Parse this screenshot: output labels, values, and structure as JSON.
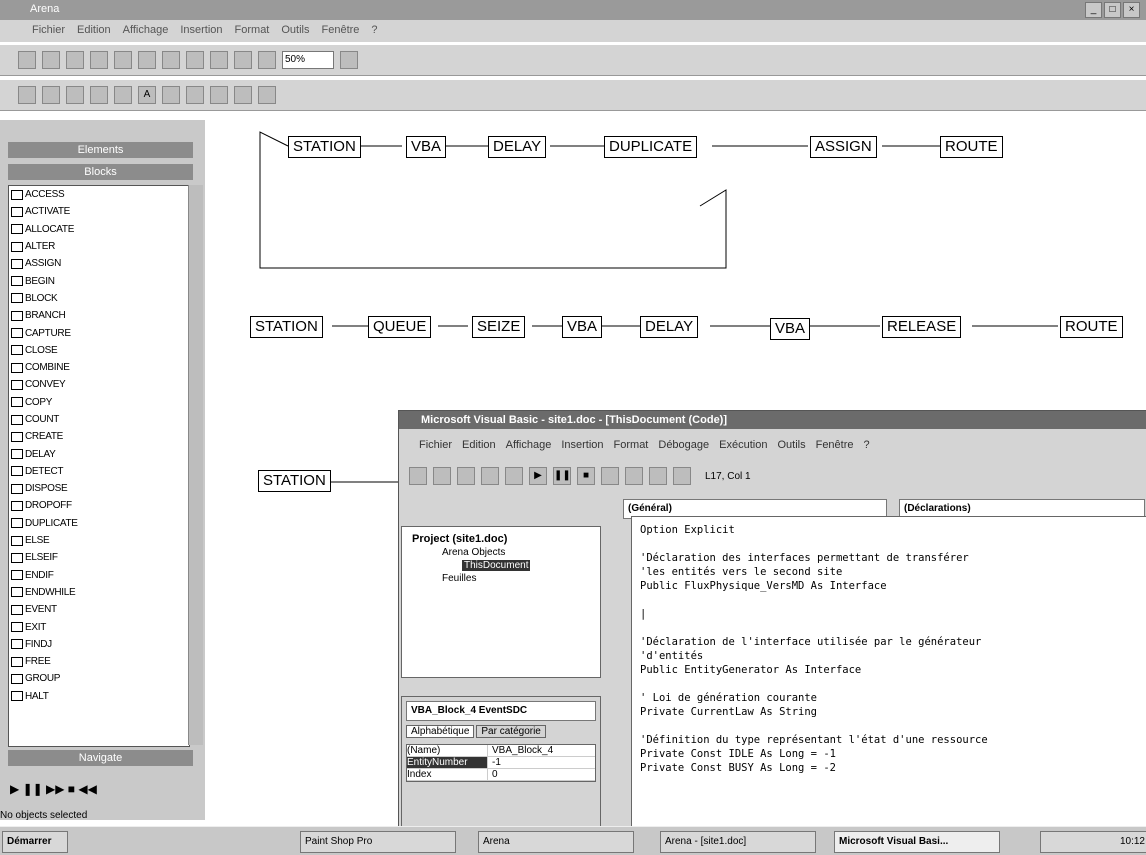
{
  "app": {
    "title": "Arena",
    "menu": [
      "Fichier",
      "Edition",
      "Affichage",
      "Insertion",
      "Format",
      "Outils",
      "Fenêtre",
      "?"
    ],
    "zoom": "50%"
  },
  "left_panel": {
    "elements_tab": "Elements",
    "blocks_tab": "Blocks",
    "blocks": [
      "ACCESS",
      "ACTIVATE",
      "ALLOCATE",
      "ALTER",
      "ASSIGN",
      "BEGIN",
      "BLOCK",
      "BRANCH",
      "CAPTURE",
      "CLOSE",
      "COMBINE",
      "CONVEY",
      "COPY",
      "COUNT",
      "CREATE",
      "DELAY",
      "DETECT",
      "DISPOSE",
      "DROPOFF",
      "DUPLICATE",
      "ELSE",
      "ELSEIF",
      "ENDIF",
      "ENDWHILE",
      "EVENT",
      "EXIT",
      "FINDJ",
      "FREE",
      "GROUP",
      "HALT"
    ],
    "navigate": "Navigate",
    "status": "No objects selected"
  },
  "diagram": {
    "row1": [
      "STATION",
      "VBA",
      "DELAY",
      "DUPLICATE",
      "ASSIGN",
      "ROUTE"
    ],
    "row2": [
      "STATION",
      "QUEUE",
      "SEIZE",
      "VBA",
      "DELAY",
      "VBA",
      "RELEASE",
      "ROUTE"
    ],
    "row3": [
      "STATION"
    ]
  },
  "vba": {
    "title": "Microsoft Visual Basic - site1.doc - [ThisDocument (Code)]",
    "menu": [
      "Fichier",
      "Edition",
      "Affichage",
      "Insertion",
      "Format",
      "Débogage",
      "Exécution",
      "Outils",
      "Fenêtre",
      "?"
    ],
    "position": "L17, Col 1",
    "object_combo": "(Général)",
    "proc_combo": "(Déclarations)",
    "project": {
      "root": "Project (site1.doc)",
      "folder1": "Arena Objects",
      "doc": "ThisDocument",
      "folder2": "Feuilles"
    },
    "properties": {
      "object": "VBA_Block_4 EventSDC",
      "tab1": "Alphabétique",
      "tab2": "Par catégorie",
      "rows": [
        {
          "name": "(Name)",
          "value": "VBA_Block_4"
        },
        {
          "name": "EntityNumber",
          "value": "-1"
        },
        {
          "name": "Index",
          "value": "0"
        }
      ]
    },
    "code": [
      "Option Explicit",
      "",
      "'Déclaration des interfaces permettant de transférer",
      "'les entités vers le second site",
      "Public FluxPhysique_VersMD As Interface",
      "",
      "|",
      "",
      "'Déclaration de l'interface utilisée par le générateur",
      "'d'entités",
      "Public EntityGenerator As Interface",
      "",
      "' Loi de génération courante",
      "Private CurrentLaw As String",
      "",
      "'Définition du type représentant l'état d'une ressource",
      "Private Const IDLE As Long = -1",
      "Private Const BUSY As Long = -2"
    ]
  },
  "taskbar": {
    "start": "Démarrer",
    "tasks": [
      "Paint Shop Pro",
      "Arena",
      "Arena - [site1.doc]",
      "Microsoft Visual Basi..."
    ],
    "clock": "10:12"
  }
}
